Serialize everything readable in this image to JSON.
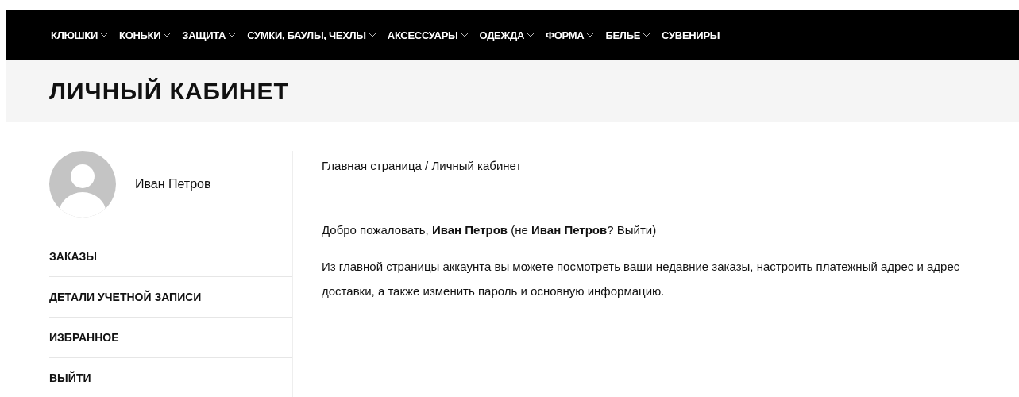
{
  "nav": [
    {
      "label": "КЛЮШКИ",
      "dropdown": true
    },
    {
      "label": "КОНЬКИ",
      "dropdown": true
    },
    {
      "label": "ЗАЩИТА",
      "dropdown": true
    },
    {
      "label": "СУМКИ, БАУЛЫ, ЧЕХЛЫ",
      "dropdown": true
    },
    {
      "label": "АКСЕССУАРЫ",
      "dropdown": true
    },
    {
      "label": "ОДЕЖДА",
      "dropdown": true
    },
    {
      "label": "ФОРМА",
      "dropdown": true
    },
    {
      "label": "БЕЛЬЕ",
      "dropdown": true
    },
    {
      "label": "СУВЕНИРЫ",
      "dropdown": false
    }
  ],
  "page_title": "ЛИЧНЫЙ КАБИНЕТ",
  "sidebar": {
    "user_name": "Иван Петров",
    "items": [
      "ЗАКАЗЫ",
      "ДЕТАЛИ УЧЕТНОЙ ЗАПИСИ",
      "ИЗБРАННОЕ",
      "ВЫЙТИ"
    ]
  },
  "breadcrumb": "Главная страница / Личный кабинет",
  "welcome": {
    "text": "Добро пожаловать, **Иван Петров** (не **Иван Петров**? ",
    "link": "Выйти",
    "suffix": ")"
  },
  "intro": "Из главной страницы аккаунта вы можете посмотреть ваши недавние заказы, настроить платежный адрес и адрес доставки, а также изменить пароль и основную информацию."
}
